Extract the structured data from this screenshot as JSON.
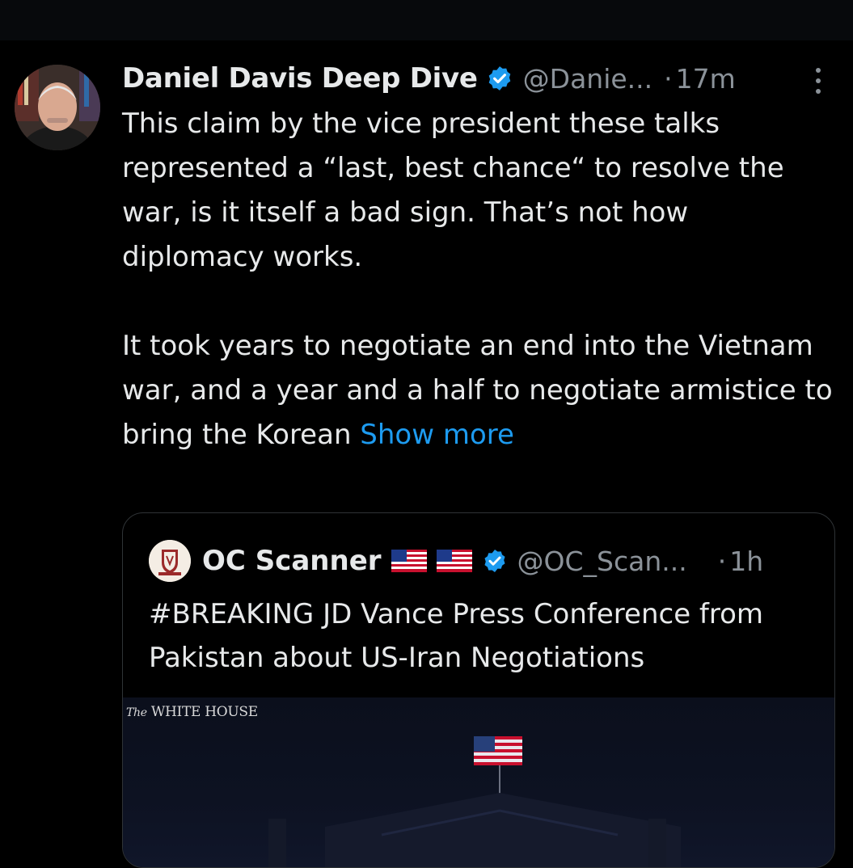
{
  "tweet": {
    "display_name": "Daniel Davis Deep Dive",
    "handle": "@Danie...",
    "separator": "·",
    "time": "17m",
    "body_paragraph_1": "This claim by the vice president these talks represented a “last, best chance“ to resolve the war, is it itself a bad sign. That’s not how diplomacy works.",
    "body_paragraph_2": "It took years to negotiate an end into the Vietnam war, and a year and a half to negotiate armistice to bring the Korean ",
    "show_more": "Show more",
    "verified_icon": "verified-badge-icon",
    "more_icon": "more-vertical-icon"
  },
  "quote": {
    "display_name": "OC Scanner",
    "flags": [
      "us-flag-icon",
      "us-flag-icon"
    ],
    "handle": "@OC_Scan...",
    "separator": "·",
    "time": "1h",
    "text": "#BREAKING JD Vance Press Conference from Pakistan about US-Iran Negotiations",
    "media_caption_the": "The",
    "media_caption_main": "WHITE HOUSE"
  },
  "colors": {
    "background": "#000000",
    "text": "#e7e9ea",
    "secondary": "#8b9299",
    "link": "#1d9bf0",
    "verified": "#1d9bf0",
    "border": "#2f3336"
  }
}
